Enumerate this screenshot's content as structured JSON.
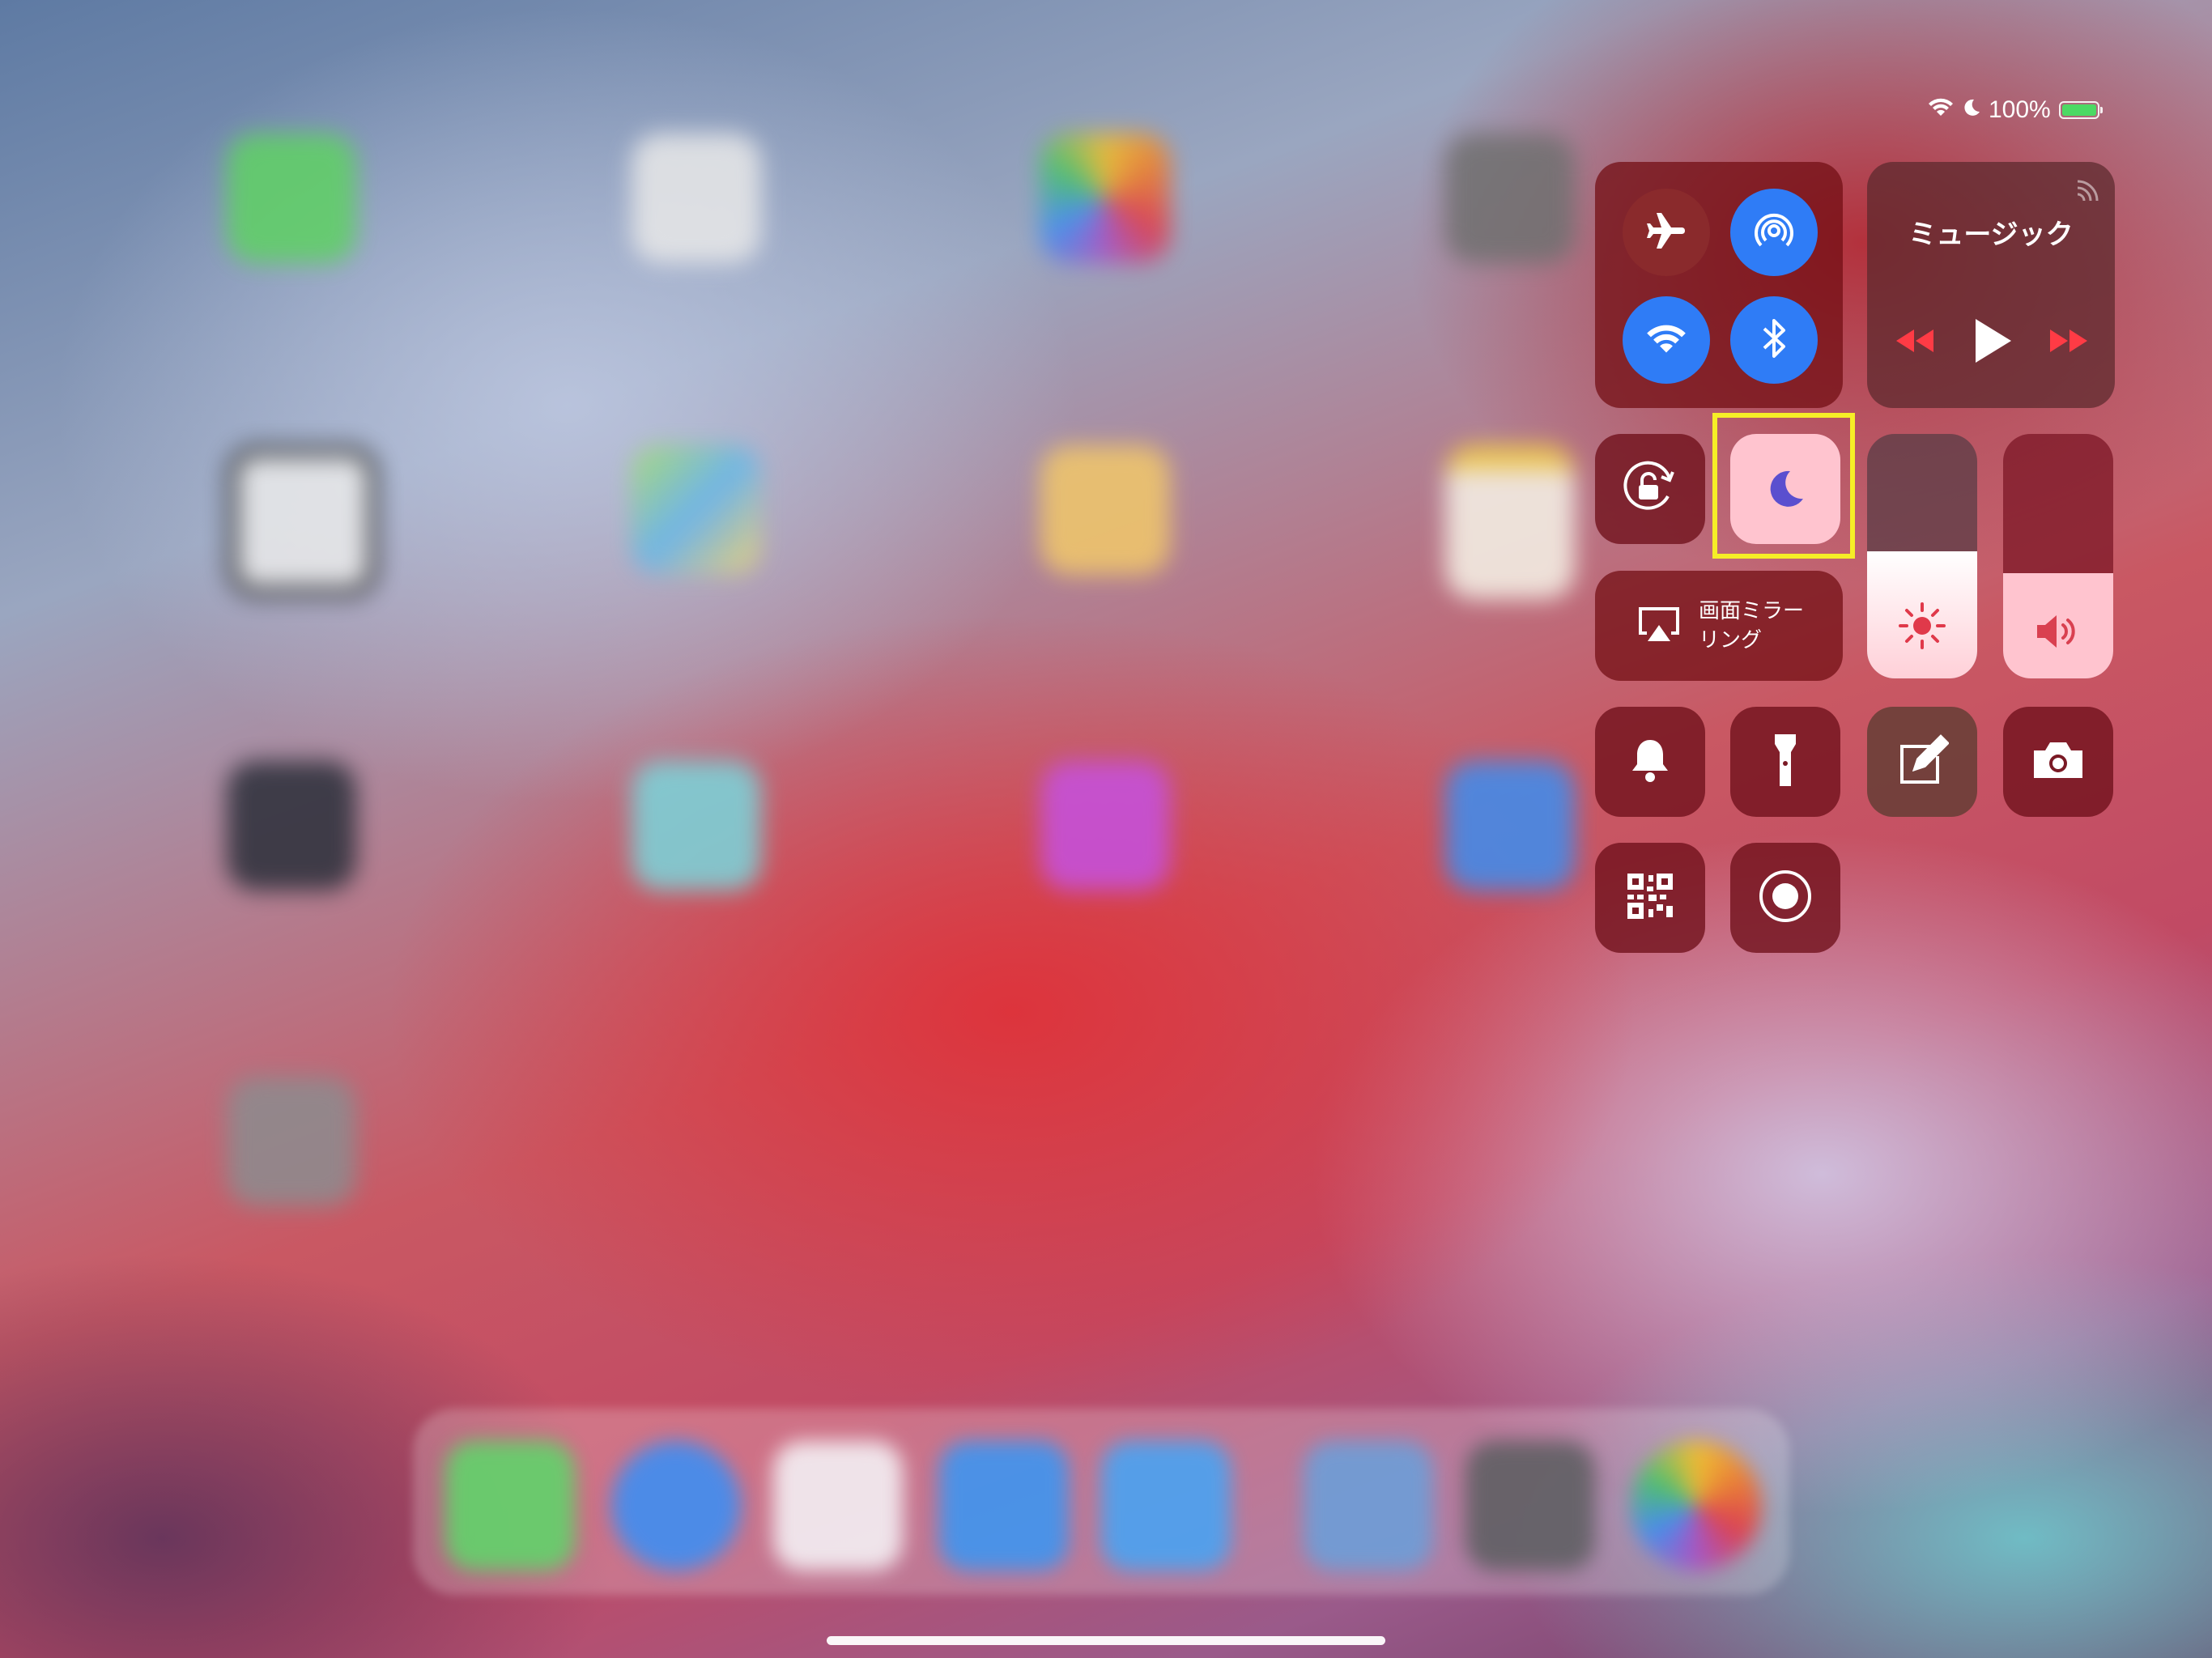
{
  "status_bar": {
    "battery_percent": "100%",
    "battery_level": 1.0,
    "battery_color": "#4cd964"
  },
  "music": {
    "title": "ミュージック"
  },
  "screen_mirroring": {
    "label_line1": "画面ミラー",
    "label_line2": "リング"
  },
  "sliders": {
    "brightness_level": 0.52,
    "volume_level": 0.43
  },
  "colors": {
    "connectivity_active": "#2f7cf6",
    "airplane_off": "#8a2a2c",
    "dnd_active_bg": "#ffc4cf",
    "dnd_moon": "#5a4fcf",
    "highlight_box": "#f6ee27",
    "playback_arrows": "#ff3b45"
  },
  "icons": [
    "airplane-icon",
    "airdrop-icon",
    "wifi-icon",
    "bluetooth-icon",
    "airplay-icon",
    "rewind-icon",
    "play-icon",
    "fast-forward-icon",
    "rotation-lock-icon",
    "moon-icon",
    "screen-mirroring-icon",
    "sun-icon",
    "speaker-icon",
    "bell-icon",
    "flashlight-icon",
    "notes-icon",
    "camera-icon",
    "qr-code-icon",
    "screen-record-icon"
  ]
}
